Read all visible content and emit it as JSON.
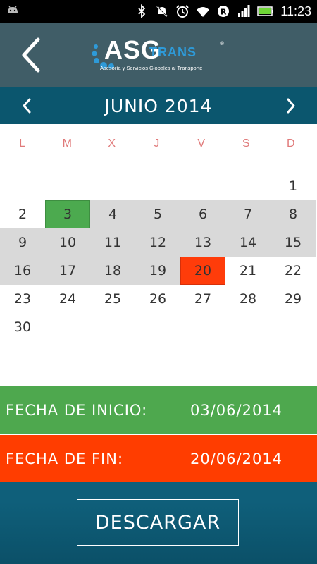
{
  "status_bar": {
    "time": "11:23",
    "icons": [
      "android-icon",
      "bluetooth-icon",
      "mute-icon",
      "alarm-icon",
      "wifi-icon",
      "roaming-icon",
      "signal-icon",
      "battery-icon"
    ]
  },
  "header": {
    "logo": {
      "name": "ASG",
      "suffix": "TRANS",
      "registered": "®",
      "tagline": "Asesoría y Servicios Globales al Transporte"
    }
  },
  "calendar": {
    "month_label": "JUNIO 2014",
    "weekdays": [
      "L",
      "M",
      "X",
      "J",
      "V",
      "S",
      "D"
    ],
    "weeks": [
      [
        "",
        "",
        "",
        "",
        "",
        "",
        "1"
      ],
      [
        "2",
        "3",
        "4",
        "5",
        "6",
        "7",
        "8"
      ],
      [
        "9",
        "10",
        "11",
        "12",
        "13",
        "14",
        "15"
      ],
      [
        "16",
        "17",
        "18",
        "19",
        "20",
        "21",
        "22"
      ],
      [
        "23",
        "24",
        "25",
        "26",
        "27",
        "28",
        "29"
      ],
      [
        "30",
        "",
        "",
        "",
        "",
        "",
        ""
      ]
    ],
    "start_day": "3",
    "end_day": "20"
  },
  "selection": {
    "start_label": "FECHA DE INICIO:",
    "start_value": "03/06/2014",
    "end_label": "FECHA DE FIN:",
    "end_value": "20/06/2014"
  },
  "actions": {
    "download_label": "DESCARGAR"
  },
  "colors": {
    "header_bg": "#405d67",
    "month_bar": "#0b566e",
    "range": "#d9d9d9",
    "start": "#4caa4f",
    "end": "#ff3c0a",
    "weekday": "#e07a7a"
  }
}
